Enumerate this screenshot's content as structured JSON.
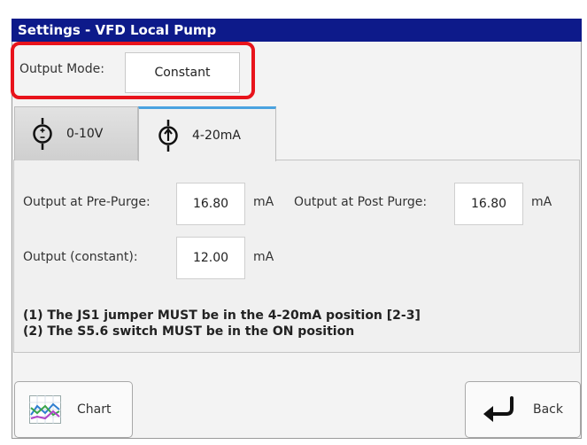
{
  "window": {
    "title": "Settings - VFD Local Pump"
  },
  "output_mode": {
    "label": "Output Mode:",
    "value": "Constant"
  },
  "tabs": [
    {
      "label": "0-10V",
      "icon": "voltage-source-icon",
      "active": false
    },
    {
      "label": "4-20mA",
      "icon": "current-source-icon",
      "active": true
    }
  ],
  "fields": {
    "pre_purge": {
      "label": "Output at Pre-Purge:",
      "value": "16.80",
      "unit": "mA"
    },
    "post_purge": {
      "label": "Output at Post Purge:",
      "value": "16.80",
      "unit": "mA"
    },
    "constant": {
      "label": "Output (constant):",
      "value": "12.00",
      "unit": "mA"
    }
  },
  "notes": [
    "(1) The JS1 jumper MUST be in the 4-20mA position [2-3]",
    "(2) The S5.6 switch MUST be in the ON position"
  ],
  "buttons": {
    "chart": "Chart",
    "back": "Back"
  },
  "colors": {
    "titlebar": "#0d1a8a",
    "highlight": "#e8131b",
    "tab_accent": "#4aa3e0"
  }
}
